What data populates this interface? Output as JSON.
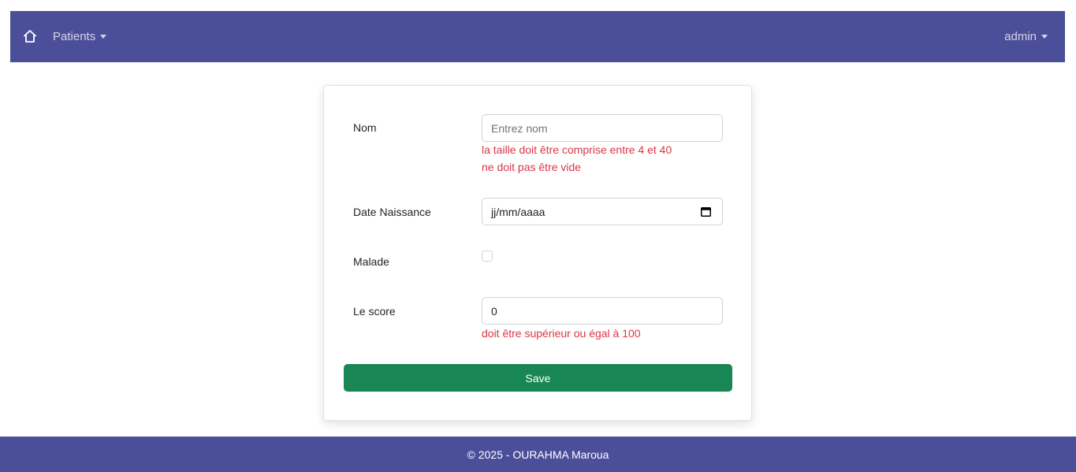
{
  "navbar": {
    "home_icon": "home-icon",
    "patients_label": "Patients",
    "admin_label": "admin",
    "background": "#4b4f99"
  },
  "form": {
    "nom": {
      "label": "Nom",
      "placeholder": "Entrez nom",
      "value": "",
      "errors": [
        "la taille doit être comprise entre 4 et 40",
        "ne doit pas être vide"
      ]
    },
    "date_naissance": {
      "label": "Date Naissance",
      "value": "jj/mm/aaaa",
      "icon": "calendar-icon"
    },
    "malade": {
      "label": "Malade",
      "checked": false
    },
    "score": {
      "label": "Le score",
      "value": "0",
      "errors": [
        "doit être supérieur ou égal à 100"
      ]
    },
    "save_label": "Save",
    "save_color": "#198754",
    "error_color": "#dc3545"
  },
  "footer": {
    "text": "© 2025 - OURAHMA Maroua"
  }
}
